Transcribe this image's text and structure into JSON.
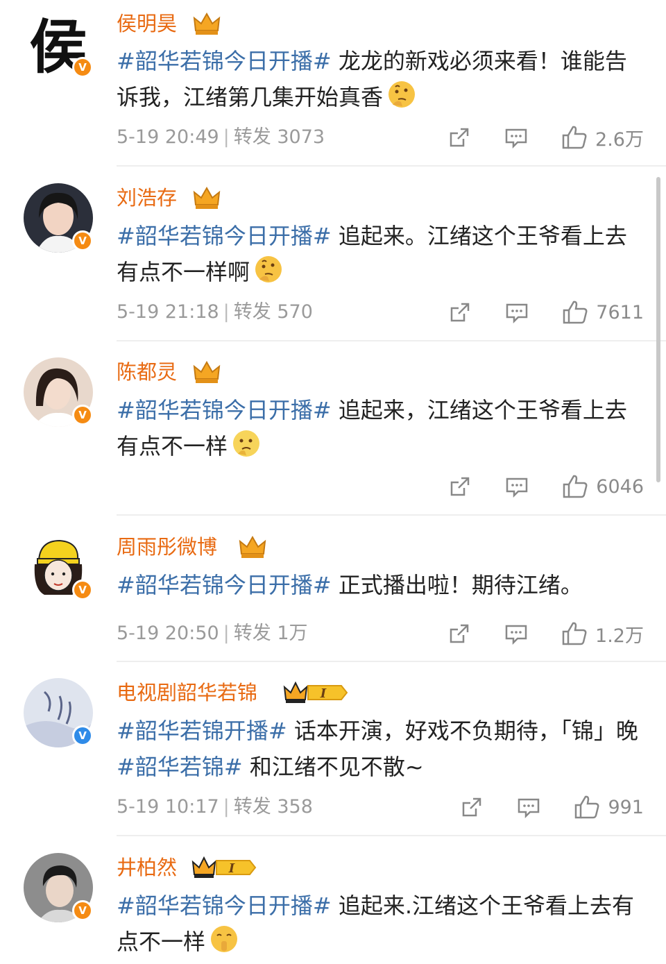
{
  "posts": [
    {
      "author": "侯明昊",
      "avatar_char": "侯",
      "verified": "orange",
      "badge": "crown",
      "content": [
        {
          "type": "tag",
          "text": "#韶华若锦今日开播#"
        },
        {
          "type": "text",
          "text": " 龙龙的新戏必须来看！谁能告诉我，江绪第几集开始真香"
        }
      ],
      "emoji": "thinking-face-icon",
      "time": "5-19 20:49",
      "repost_label": "转发 3073",
      "likes": "2.6万"
    },
    {
      "author": "刘浩存",
      "verified": "orange",
      "badge": "crown",
      "content": [
        {
          "type": "tag",
          "text": "#韶华若锦今日开播#"
        },
        {
          "type": "text",
          "text": " 追起来。江绪这个王爷看上去有点不一样啊"
        }
      ],
      "emoji": "thinking-face-icon",
      "time": "5-19 21:18",
      "repost_label": "转发 570",
      "likes": "7611"
    },
    {
      "author": "陈都灵",
      "verified": "orange",
      "badge": "crown",
      "content": [
        {
          "type": "tag",
          "text": "#韶华若锦今日开播#"
        },
        {
          "type": "text",
          "text": " 追起来，江绪这个王爷看上去有点不一样"
        }
      ],
      "emoji": "thinking-face-icon",
      "time": "",
      "repost_label": "",
      "likes": "6046"
    },
    {
      "author": "周雨彤微博",
      "verified": "orange",
      "badge": "crown",
      "content": [
        {
          "type": "tag",
          "text": "#韶华若锦今日开播#"
        },
        {
          "type": "text",
          "text": " 正式播出啦！期待江绪。"
        }
      ],
      "emoji": "",
      "time": "5-19 20:50",
      "repost_label": "转发 1万",
      "likes": "1.2万"
    },
    {
      "author": "电视剧韶华若锦",
      "verified": "blue",
      "badge": "crown-level",
      "badge_level": "I",
      "content": [
        {
          "type": "tag",
          "text": "#韶华若锦开播#"
        },
        {
          "type": "text",
          "text": " 话本开演，好戏不负期待，「锦」晚"
        },
        {
          "type": "tag",
          "text": "#韶华若锦#"
        },
        {
          "type": "text",
          "text": " 和江绪不见不散~"
        }
      ],
      "emoji": "",
      "time": "5-19 10:17",
      "repost_label": "转发 358",
      "likes": "991"
    },
    {
      "author": "井柏然",
      "verified": "orange",
      "badge": "crown-level",
      "badge_level": "I",
      "content": [
        {
          "type": "tag",
          "text": "#韶华若锦今日开播#"
        },
        {
          "type": "text",
          "text": " 追起来.江绪这个王爷看上去有点不一样"
        }
      ],
      "emoji": "shushing-face-icon",
      "time": "",
      "repost_label": "",
      "likes": ""
    }
  ],
  "icons": {
    "repost": "share-icon",
    "comment": "comment-icon",
    "like": "thumbs-up-icon"
  },
  "colors": {
    "username": "#e86a12",
    "hashtag": "#3b6ea8",
    "meta": "#9a9a9a",
    "verified_orange": "#f58b13",
    "verified_blue": "#2f8be8"
  }
}
